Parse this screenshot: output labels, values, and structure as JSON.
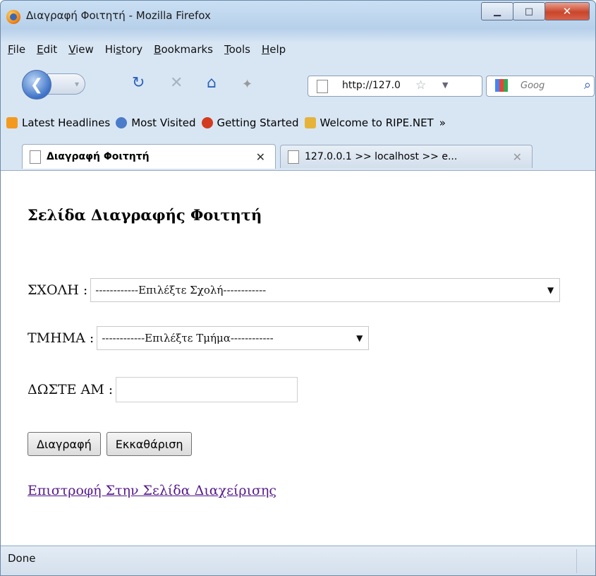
{
  "window": {
    "title": "Διαγραφή Φοιτητή - Mozilla Firefox"
  },
  "menu": [
    "File",
    "Edit",
    "View",
    "History",
    "Bookmarks",
    "Tools",
    "Help"
  ],
  "menu_accel": [
    "F",
    "E",
    "V",
    "s",
    "B",
    "T",
    "H"
  ],
  "nav": {
    "url": "http://127.0",
    "search_placeholder": "Goog"
  },
  "bookmarks": [
    {
      "label": "Latest Headlines",
      "icon": "rss-icon",
      "color": "#f39a1e"
    },
    {
      "label": "Most Visited",
      "icon": "globe-icon",
      "color": "#4a7cc9"
    },
    {
      "label": "Getting Started",
      "icon": "firefox-icon",
      "color": "#d23b1e"
    },
    {
      "label": "Welcome to RIPE.NET",
      "icon": "ripe-icon",
      "color": "#e6b33a"
    }
  ],
  "bookmarks_more": "»",
  "tabs": [
    {
      "label": "Διαγραφή Φοιτητή",
      "active": true
    },
    {
      "label": "127.0.0.1 >> localhost >> e...",
      "active": false
    }
  ],
  "page": {
    "heading": "Σελίδα Διαγραφής Φοιτητή",
    "school_label": "ΣΧΟΛΗ :",
    "school_select": "------------Επιλέξτε Σχολή------------",
    "dept_label": "ΤΜΗΜΑ :",
    "dept_select": "------------Επιλέξτε Τμήμα------------",
    "am_label": "ΔΩΣΤΕ ΑΜ :",
    "am_value": "",
    "delete_button": "Διαγραφή",
    "clear_button": "Εκκαθάριση",
    "back_link": "Επιστροφή Στην Σελίδα Διαχείρισης"
  },
  "status": "Done"
}
